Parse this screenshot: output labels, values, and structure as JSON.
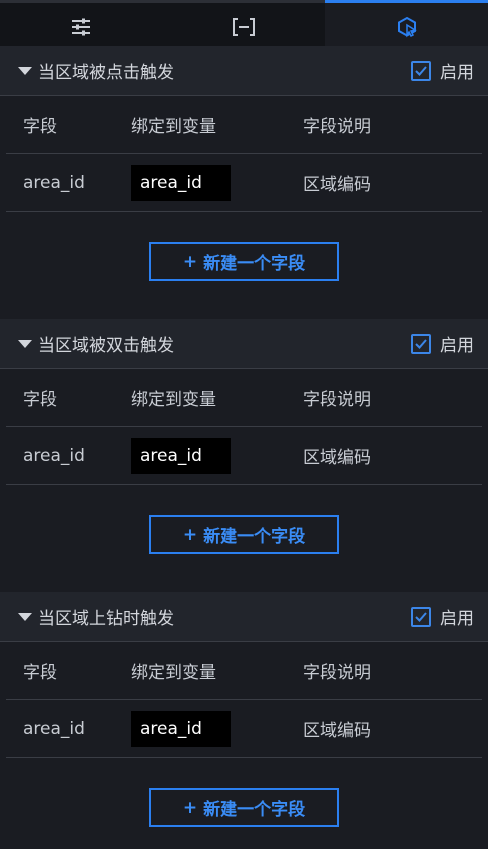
{
  "tabs": [
    {
      "icon": "sliders-icon"
    },
    {
      "icon": "bracket-minus-icon"
    },
    {
      "icon": "interaction-icon"
    }
  ],
  "colors": {
    "accent": "#2b7ff0",
    "background": "#1a1c22",
    "header": "#22252c"
  },
  "columns": {
    "field": "字段",
    "variable": "绑定到变量",
    "desc": "字段说明"
  },
  "add_button_label": "新建一个字段",
  "add_button_plus": "+",
  "sections": [
    {
      "title": "当区域被点击触发",
      "enable_label": "启用",
      "enabled": true,
      "rows": [
        {
          "field": "area_id",
          "variable": "area_id",
          "desc": "区域编码"
        }
      ]
    },
    {
      "title": "当区域被双击触发",
      "enable_label": "启用",
      "enabled": true,
      "rows": [
        {
          "field": "area_id",
          "variable": "area_id",
          "desc": "区域编码"
        }
      ]
    },
    {
      "title": "当区域上钻时触发",
      "enable_label": "启用",
      "enabled": true,
      "rows": [
        {
          "field": "area_id",
          "variable": "area_id",
          "desc": "区域编码"
        }
      ]
    }
  ]
}
